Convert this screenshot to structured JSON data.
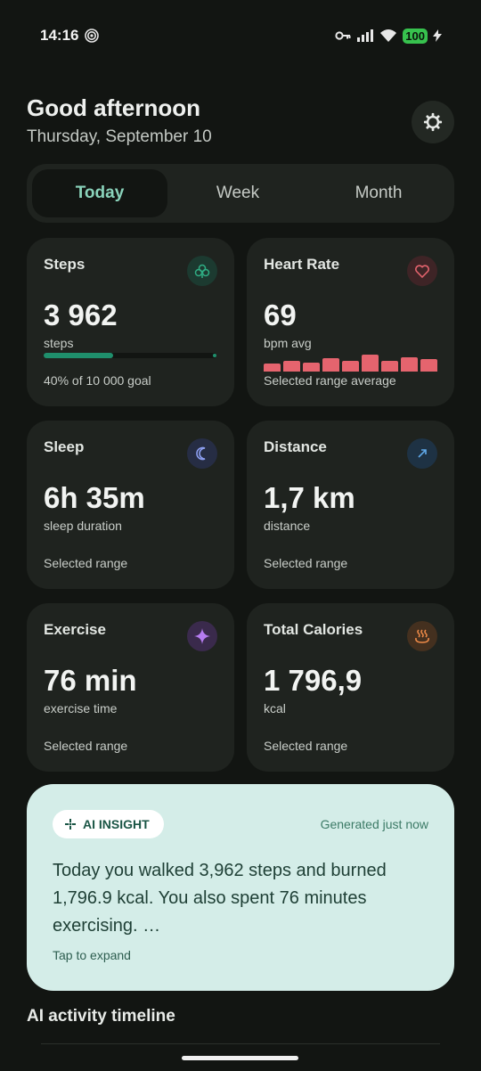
{
  "status": {
    "time": "14:16",
    "battery": "100"
  },
  "header": {
    "greeting": "Good afternoon",
    "date": "Thursday, September 10"
  },
  "tabs": [
    {
      "label": "Today"
    },
    {
      "label": "Week"
    },
    {
      "label": "Month"
    }
  ],
  "cards": {
    "steps": {
      "title": "Steps",
      "value": "3 962",
      "unit": "steps",
      "footer": "40% of 10 000 goal",
      "progress_fraction": 0.4,
      "icon": "footprints-icon",
      "color": "#1f8f6c"
    },
    "heart": {
      "title": "Heart Rate",
      "value": "69",
      "unit": "bpm avg",
      "footer": "Selected range average",
      "icon": "heart-icon",
      "color": "#e5646e",
      "bars": [
        0.45,
        0.65,
        0.55,
        0.8,
        0.65,
        1.0,
        0.65,
        0.85,
        0.75
      ]
    },
    "sleep": {
      "title": "Sleep",
      "value": "6h 35m",
      "unit": "sleep duration",
      "footer": "Selected range",
      "icon": "moon-icon",
      "color": "#8c9ef0"
    },
    "distance": {
      "title": "Distance",
      "value": "1,7 km",
      "unit": "distance",
      "footer": "Selected range",
      "icon": "arrow-up-right-icon",
      "color": "#5fa8e8"
    },
    "exercise": {
      "title": "Exercise",
      "value": "76 min",
      "unit": "exercise time",
      "footer": "Selected range",
      "icon": "sparkle-icon",
      "color": "#b57cf0"
    },
    "calories": {
      "title": "Total Calories",
      "value": "1 796,9",
      "unit": "kcal",
      "footer": "Selected range",
      "icon": "hot-springs-icon",
      "color": "#ee8a48"
    }
  },
  "insight": {
    "chip": "AI INSIGHT",
    "generated": "Generated just now",
    "text": "Today you walked 3,962 steps and burned 1,796.9 kcal. You also spent 76 minutes exercising. …",
    "expand": "Tap to expand"
  },
  "timeline": {
    "title": "AI activity timeline"
  }
}
